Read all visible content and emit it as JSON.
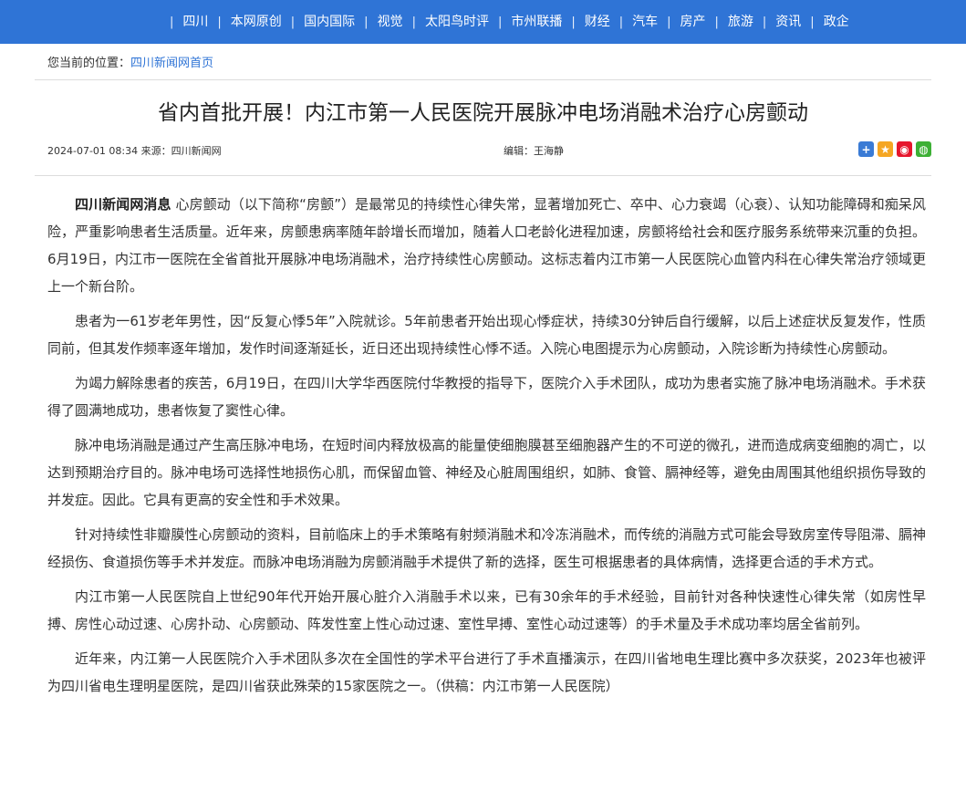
{
  "nav": {
    "items": [
      "四川",
      "本网原创",
      "国内国际",
      "视觉",
      "太阳鸟时评",
      "市州联播",
      "财经",
      "汽车",
      "房产",
      "旅游",
      "资讯",
      "政企"
    ]
  },
  "breadcrumb": {
    "prefix": "您当前的位置：",
    "link": "四川新闻网首页"
  },
  "article": {
    "title": "省内首批开展！内江市第一人民医院开展脉冲电场消融术治疗心房颤动",
    "datetime": "2024-07-01 08:34",
    "source_label": "来源：",
    "source": "四川新闻网",
    "editor_label": "编辑：",
    "editor": "王海静",
    "lead": "四川新闻网消息",
    "paragraphs": [
      "心房颤动（以下简称“房颤”）是最常见的持续性心律失常，显著增加死亡、卒中、心力衰竭（心衰）、认知功能障碍和痴呆风险，严重影响患者生活质量。近年来，房颤患病率随年龄增长而增加，随着人口老龄化进程加速，房颤将给社会和医疗服务系统带来沉重的负担。6月19日，内江市一医院在全省首批开展脉冲电场消融术，治疗持续性心房颤动。这标志着内江市第一人民医院心血管内科在心律失常治疗领域更上一个新台阶。",
      "患者为一61岁老年男性，因“反复心悸5年”入院就诊。5年前患者开始出现心悸症状，持续30分钟后自行缓解，以后上述症状反复发作，性质同前，但其发作频率逐年增加，发作时间逐渐延长，近日还出现持续性心悸不适。入院心电图提示为心房颤动，入院诊断为持续性心房颤动。",
      "为竭力解除患者的疾苦，6月19日，在四川大学华西医院付华教授的指导下，医院介入手术团队，成功为患者实施了脉冲电场消融术。手术获得了圆满地成功，患者恢复了窦性心律。",
      "脉冲电场消融是通过产生高压脉冲电场，在短时间内释放极高的能量使细胞膜甚至细胞器产生的不可逆的微孔，进而造成病变细胞的凋亡，以达到预期治疗目的。脉冲电场可选择性地损伤心肌，而保留血管、神经及心脏周围组织，如肺、食管、膈神经等，避免由周围其他组织损伤导致的并发症。因此。它具有更高的安全性和手术效果。",
      "针对持续性非瓣膜性心房颤动的资料，目前临床上的手术策略有射频消融术和冷冻消融术，而传统的消融方式可能会导致房室传导阻滞、膈神经损伤、食道损伤等手术并发症。而脉冲电场消融为房颤消融手术提供了新的选择，医生可根据患者的具体病情，选择更合适的手术方式。",
      "内江市第一人民医院自上世纪90年代开始开展心脏介入消融手术以来，已有30余年的手术经验，目前针对各种快速性心律失常（如房性早搏、房性心动过速、心房扑动、心房颤动、阵发性室上性心动过速、室性早搏、室性心动过速等）的手术量及手术成功率均居全省前列。",
      "近年来，内江第一人民医院介入手术团队多次在全国性的学术平台进行了手术直播演示，在四川省地电生理比赛中多次获奖，2023年也被评为四川省电生理明星医院，是四川省获此殊荣的15家医院之一。（供稿：内江市第一人民医院）"
    ]
  },
  "share": {
    "icons": [
      {
        "name": "share-plus-icon",
        "glyph": "+",
        "color": "#3a7bd5"
      },
      {
        "name": "qzone-icon",
        "glyph": "★",
        "color": "#f5a623"
      },
      {
        "name": "weibo-icon",
        "glyph": "◉",
        "color": "#e6162d"
      },
      {
        "name": "wechat-icon",
        "glyph": "◍",
        "color": "#3db035"
      }
    ]
  },
  "colors": {
    "nav_bg": "#2f74d6",
    "link": "#2f74d6"
  }
}
